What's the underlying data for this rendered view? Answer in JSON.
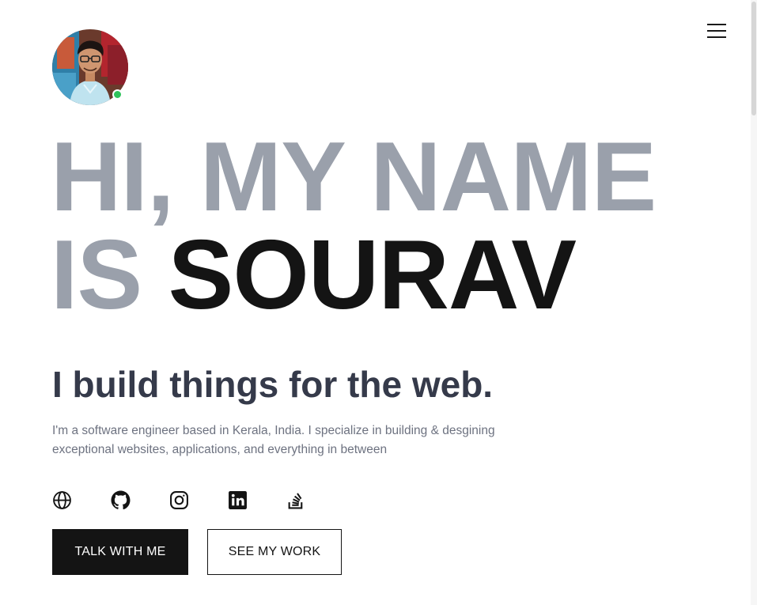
{
  "header": {
    "menu_icon": "hamburger-menu-icon"
  },
  "profile": {
    "avatar": "profile-photo",
    "status": "online",
    "status_color": "#2fc35b"
  },
  "hero": {
    "headline_line1": "HI, MY NAME",
    "headline_line2_prefix": "IS ",
    "headline_name": "SOURAV",
    "tagline": "I build things for the web.",
    "bio": "I'm a software engineer based in Kerala, India. I specialize in building & desgining exceptional websites, applications, and everything in between"
  },
  "socials": [
    {
      "icon": "globe-icon"
    },
    {
      "icon": "github-icon"
    },
    {
      "icon": "instagram-icon"
    },
    {
      "icon": "linkedin-icon"
    },
    {
      "icon": "stackoverflow-icon"
    }
  ],
  "actions": {
    "primary_label": "TALK WITH ME",
    "secondary_label": "SEE MY WORK"
  },
  "colors": {
    "headline_muted": "#9aa0ab",
    "headline_name": "#141414",
    "tagline": "#353a4a",
    "bio": "#6d7280",
    "primary_button_bg": "#141414"
  }
}
